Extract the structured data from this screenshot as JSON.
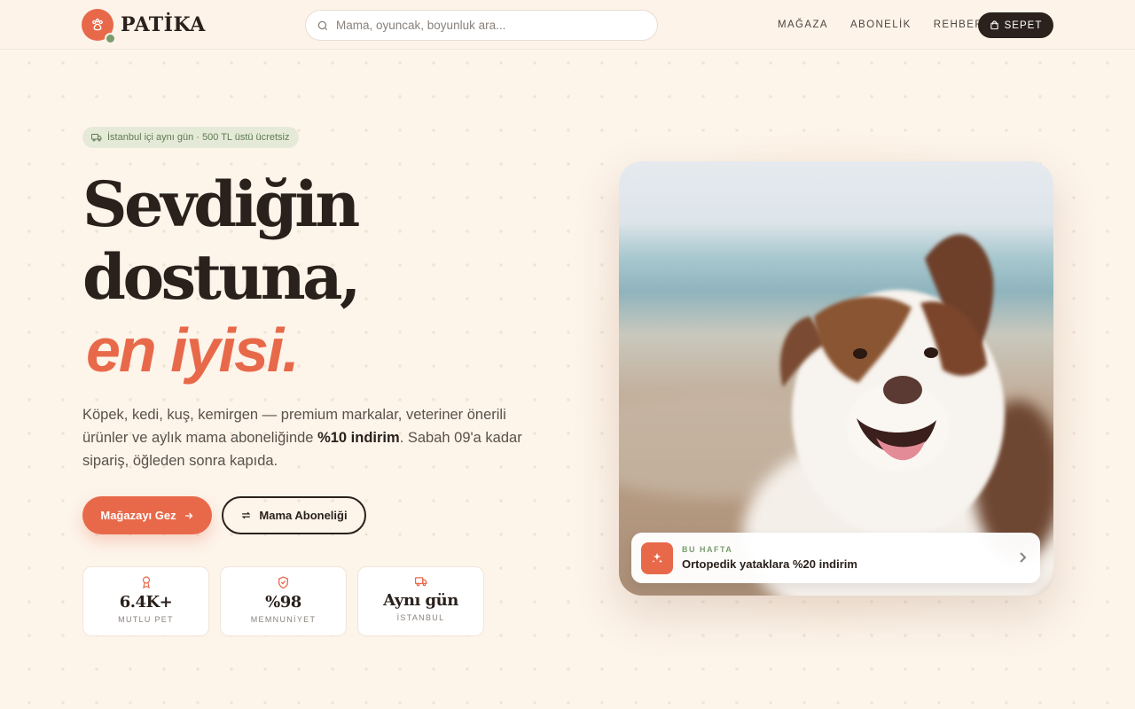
{
  "brand": {
    "name": "PATİKA",
    "accent": "#e8694a",
    "secondary": "#7a9c6e",
    "dark": "#2a211c"
  },
  "search": {
    "placeholder": "Mama, oyuncak, boyunluk ara..."
  },
  "nav": {
    "items": [
      {
        "label": "MAĞAZA"
      },
      {
        "label": "ABONELİK"
      },
      {
        "label": "REHBER"
      }
    ],
    "cart_label": "SEPET"
  },
  "hero": {
    "badge": "İstanbul içi aynı gün · 500 TL üstü ücretsiz",
    "headline_line1": "Sevdiğin",
    "headline_line2": "dostuna,",
    "headline_accent": "en iyisi.",
    "desc_pre": "Köpek, kedi, kuş, kemirgen — premium markalar, veteriner önerili ürünler ve aylık mama aboneliğinde ",
    "desc_bold": "%10 indirim",
    "desc_post": ". Sabah 09'a kadar sipariş, öğleden sonra kapıda.",
    "primary_button": "Mağazayı Gez",
    "secondary_button": "Mama Aboneliği"
  },
  "stats": [
    {
      "icon": "award-icon",
      "value": "6.4K+",
      "label": "MUTLU PET"
    },
    {
      "icon": "shield-check-icon",
      "value": "%98",
      "label": "MEMNUNİYET"
    },
    {
      "icon": "truck-icon",
      "value": "Aynı gün",
      "label": "İSTANBUL"
    }
  ],
  "promo": {
    "kicker": "BU HAFTA",
    "title": "Ortopedik yataklara %20 indirim",
    "icon": "sparkles-icon"
  }
}
